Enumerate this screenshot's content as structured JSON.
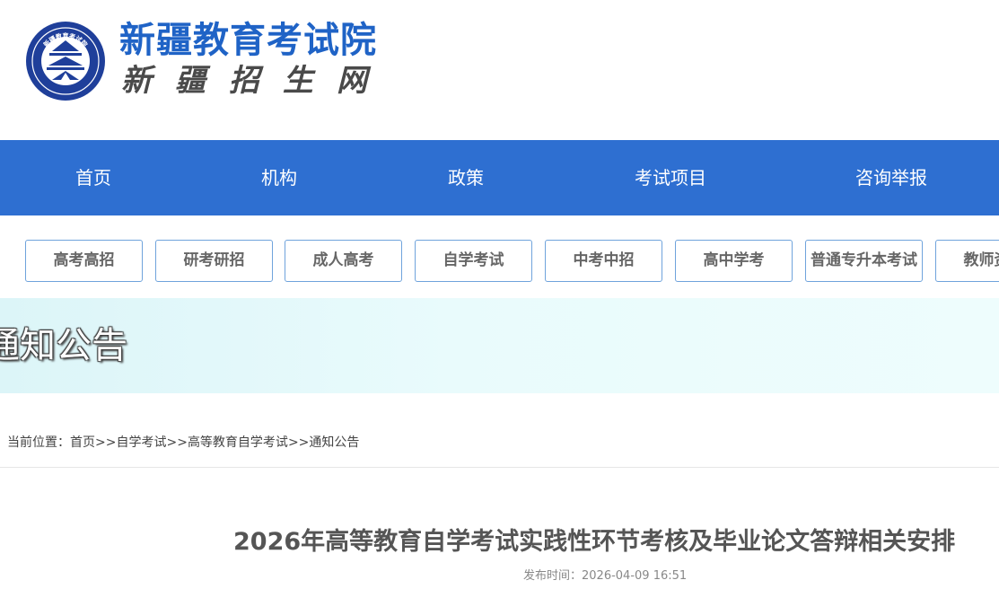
{
  "header": {
    "logo_emblem_text": "新疆教育考试院",
    "title": "新疆教育考试院",
    "subtitle": "新疆招生网",
    "brand_color": "#1f63c6"
  },
  "main_nav": {
    "background": "#2e6fd1",
    "items": [
      {
        "label": "首页"
      },
      {
        "label": "机构"
      },
      {
        "label": "政策"
      },
      {
        "label": "考试项目"
      },
      {
        "label": "咨询举报"
      }
    ]
  },
  "sub_nav": {
    "items": [
      {
        "label": "高考高招"
      },
      {
        "label": "研考研招"
      },
      {
        "label": "成人高考"
      },
      {
        "label": "自学考试"
      },
      {
        "label": "中考中招"
      },
      {
        "label": "高中学考"
      },
      {
        "label": "普通专升本考试"
      },
      {
        "label": "教师资格"
      }
    ]
  },
  "banner": {
    "title": "通知公告"
  },
  "breadcrumb": {
    "prefix": "当前位置：",
    "items": [
      {
        "label": "首页"
      },
      {
        "label": "自学考试"
      },
      {
        "label": "高等教育自学考试"
      },
      {
        "label": "通知公告"
      }
    ],
    "separator": ">>"
  },
  "article": {
    "title": "2026年高等教育自学考试实践性环节考核及毕业论文答辩相关安排",
    "publish_label": "发布时间：",
    "publish_time": "2026-04-09 16:51"
  }
}
